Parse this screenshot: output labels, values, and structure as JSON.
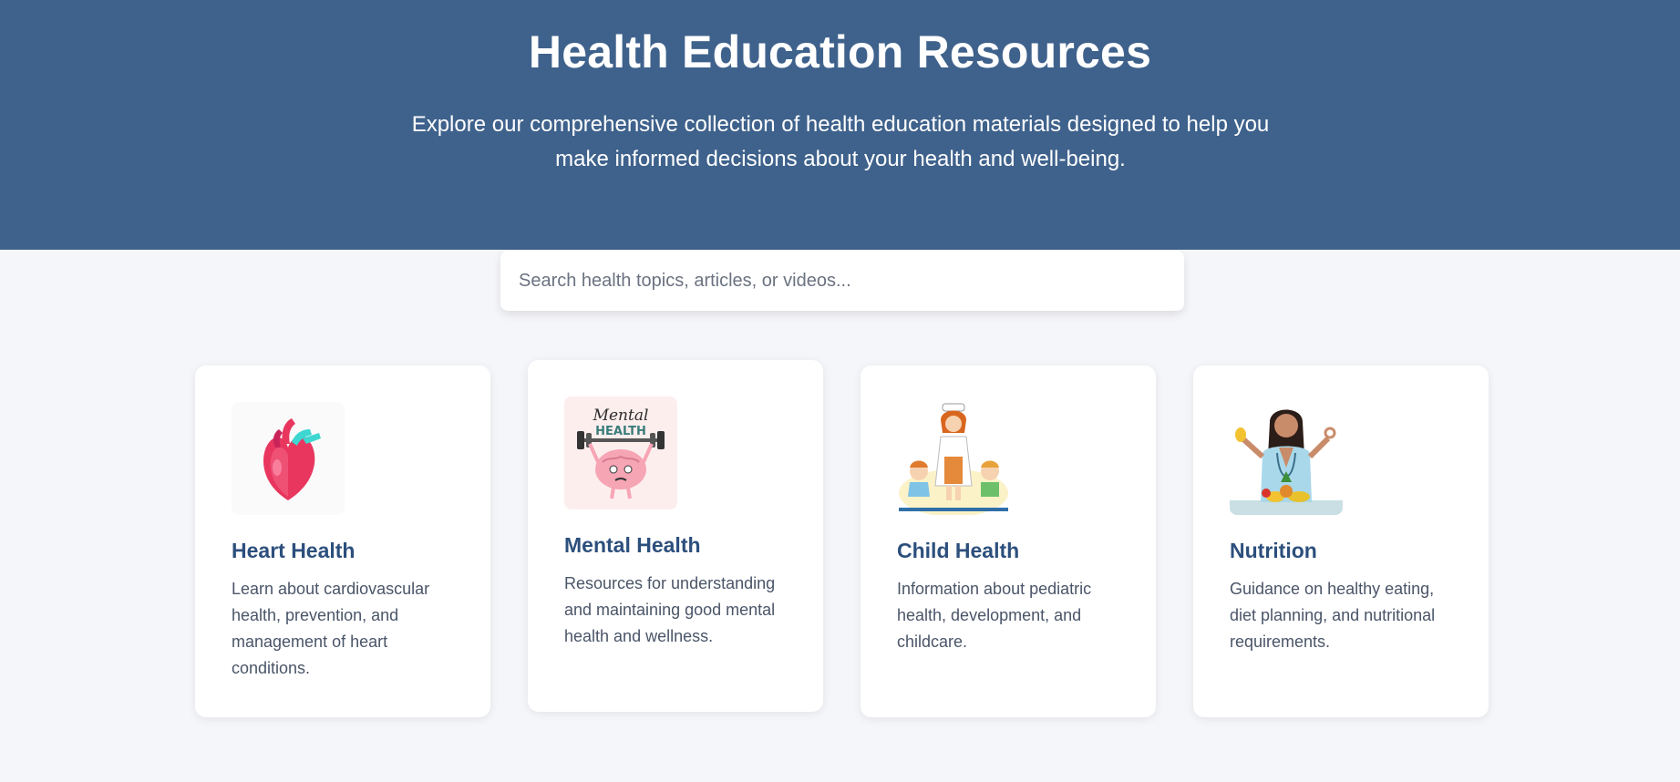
{
  "hero": {
    "title": "Health Education Resources",
    "subtitle": "Explore our comprehensive collection of health education materials designed to help you make informed decisions about your health and well-being."
  },
  "search": {
    "placeholder": "Search health topics, articles, or videos...",
    "value": ""
  },
  "cards": [
    {
      "title": "Heart Health",
      "description": "Learn about cardiovascular health, prevention, and management of heart conditions.",
      "image": "heart-illustration"
    },
    {
      "title": "Mental Health",
      "description": "Resources for understanding and maintaining good mental health and wellness.",
      "image": "brain-lifting-barbell-illustration",
      "image_text": "Mental HEALTH"
    },
    {
      "title": "Child Health",
      "description": "Information about pediatric health, development, and childcare.",
      "image": "nurse-with-children-illustration"
    },
    {
      "title": "Nutrition",
      "description": "Guidance on healthy eating, diet planning, and nutritional requirements.",
      "image": "nutritionist-with-fruits-illustration"
    }
  ],
  "colors": {
    "hero_bg": "#3f628c",
    "page_bg": "#f5f6f9",
    "card_title": "#2c4f7c",
    "card_text": "#4a5568"
  }
}
